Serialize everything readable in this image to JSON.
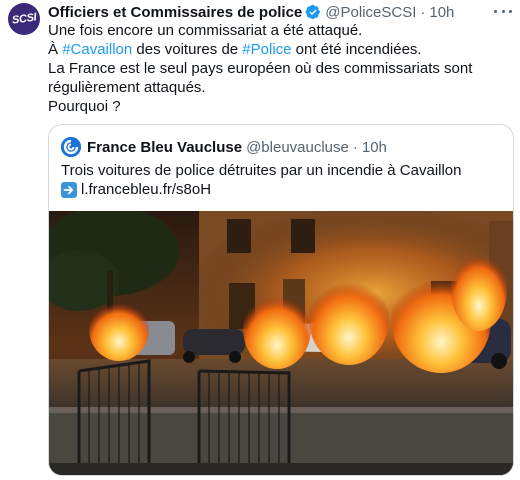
{
  "tweet": {
    "avatar_text": "SCSI",
    "author_name": "Officiers et Commissaires de police",
    "handle": "@PoliceSCSI",
    "separator": "·",
    "time": "10h",
    "verified_icon": "verified-badge-icon",
    "more_icon": "more-options-icon",
    "body": {
      "line1": "Une fois encore un commissariat a été attaqué.",
      "line2_prefix": "À ",
      "line2_hashtag1": "#Cavaillon",
      "line2_middle": " des voitures de ",
      "line2_hashtag2": "#Police",
      "line2_suffix": " ont été incendiées.",
      "line3": "La France est le seul pays européen où des commissariats sont",
      "line4": "régulièrement attaqués.",
      "line5": "Pourquoi ?"
    }
  },
  "quote": {
    "author_name": "France Bleu Vaucluse",
    "handle": "@bleuvaucluse",
    "separator": "·",
    "time": "10h",
    "text": "Trois voitures de police détruites par un incendie à Cavaillon",
    "link": "l.francebleu.fr/s8oH",
    "link_icon": "right-arrow-icon",
    "image_icon": "burning-police-cars-photo"
  },
  "colors": {
    "link": "#1d9bf0",
    "secondary_text": "#536471",
    "primary_text": "#0f1419",
    "border": "#cfd9de",
    "verified": "#1d9bf0"
  }
}
